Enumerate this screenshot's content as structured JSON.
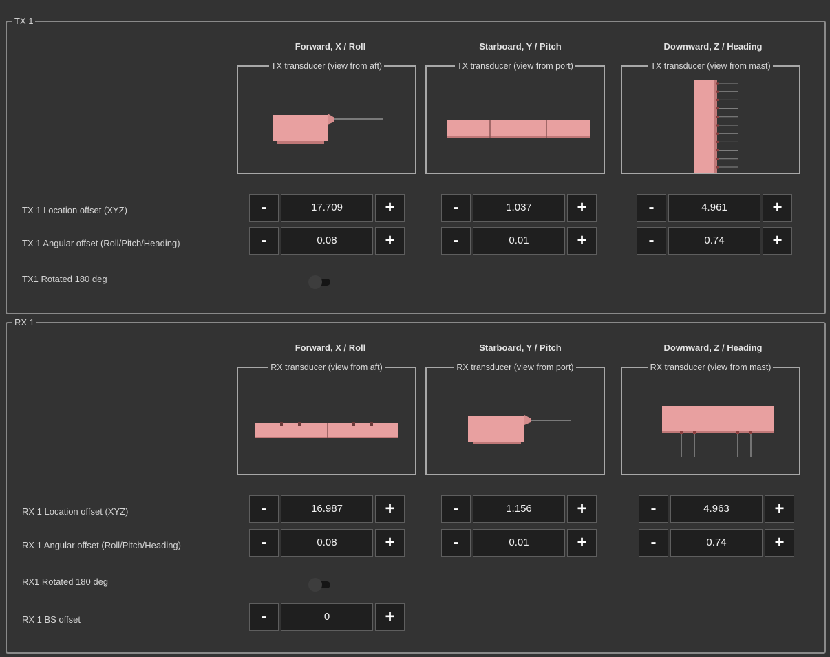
{
  "tx": {
    "legend": "TX 1",
    "columns": [
      "Forward, X / Roll",
      "Starboard, Y / Pitch",
      "Downward, Z / Heading"
    ],
    "views": [
      "TX transducer (view from aft)",
      "TX transducer (view from port)",
      "TX transducer (view from mast)"
    ],
    "location_label": "TX 1 Location offset (XYZ)",
    "location": [
      "17.709",
      "1.037",
      "4.961"
    ],
    "angular_label": "TX 1 Angular offset (Roll/Pitch/Heading)",
    "angular": [
      "0.08",
      "0.01",
      "0.74"
    ],
    "rotated_label": "TX1 Rotated 180 deg",
    "rotated": false
  },
  "rx": {
    "legend": "RX 1",
    "columns": [
      "Forward, X / Roll",
      "Starboard, Y / Pitch",
      "Downward, Z / Heading"
    ],
    "views": [
      "RX transducer (view from aft)",
      "RX transducer (view from port)",
      "RX transducer (view from mast)"
    ],
    "location_label": "RX 1 Location offset (XYZ)",
    "location": [
      "16.987",
      "1.156",
      "4.963"
    ],
    "angular_label": "RX 1 Angular offset (Roll/Pitch/Heading)",
    "angular": [
      "0.08",
      "0.01",
      "0.74"
    ],
    "rotated_label": "RX1 Rotated 180 deg",
    "rotated": false,
    "bs_label": "RX 1 BS offset",
    "bs": "0"
  },
  "buttons": {
    "minus": "-",
    "plus": "+"
  },
  "colors": {
    "transducer": "#e8a0a0",
    "background": "#333333"
  }
}
